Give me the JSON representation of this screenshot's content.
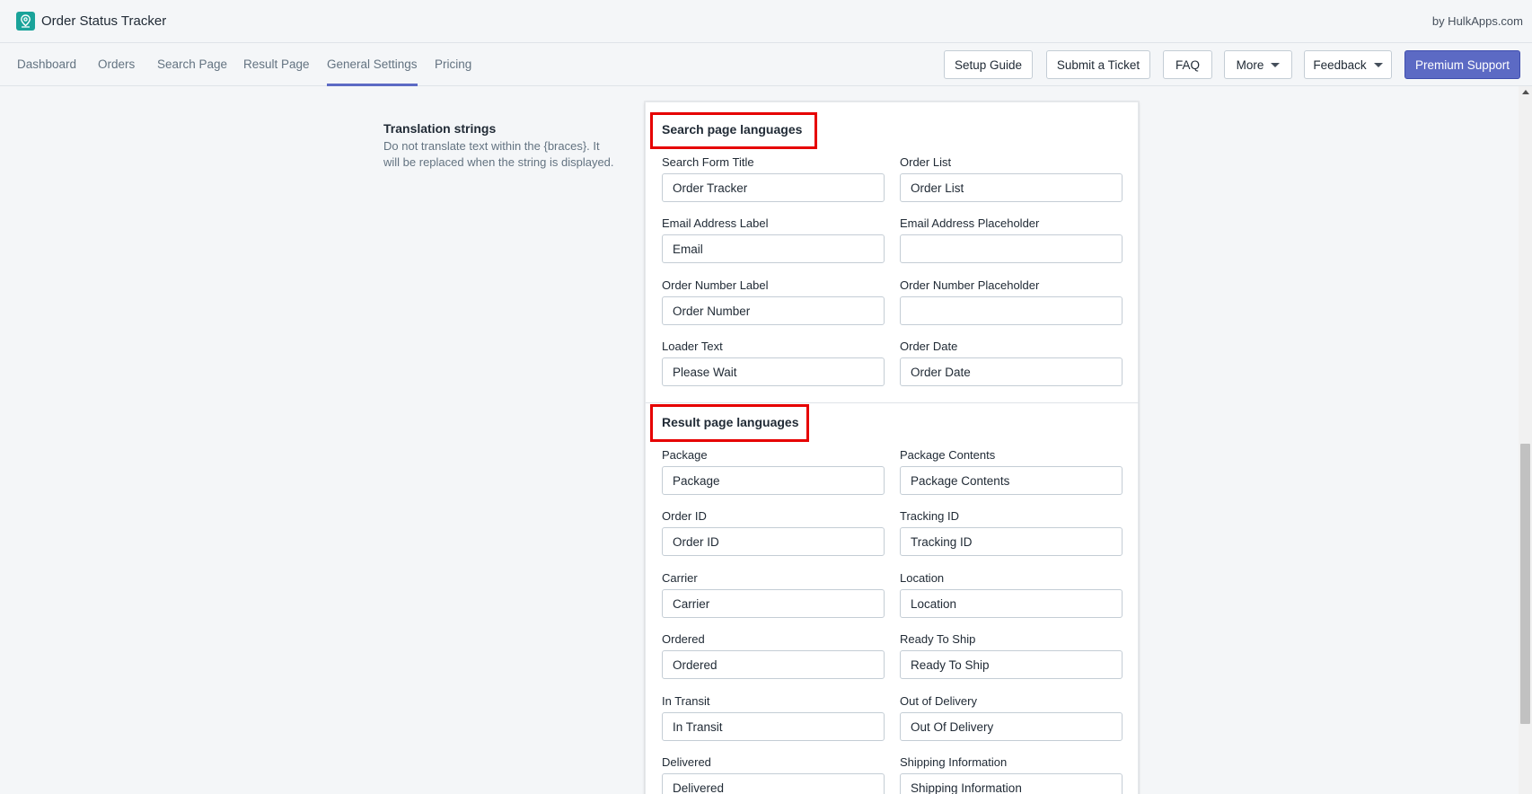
{
  "app": {
    "title": "Order Status Tracker",
    "by_line": "by HulkApps.com",
    "logo_icon": "map-pin-icon"
  },
  "nav": {
    "tabs": [
      {
        "label": "Dashboard"
      },
      {
        "label": "Orders"
      },
      {
        "label": "Search Page"
      },
      {
        "label": "Result Page"
      },
      {
        "label": "General Settings",
        "active": true
      },
      {
        "label": "Pricing"
      }
    ],
    "buttons": {
      "setup_guide": "Setup Guide",
      "submit_ticket": "Submit a Ticket",
      "faq": "FAQ",
      "more": "More",
      "feedback": "Feedback",
      "premium_support": "Premium Support"
    }
  },
  "section": {
    "title": "Translation strings",
    "description": "Do not translate text within the {braces}. It will be replaced when the string is displayed."
  },
  "search_page": {
    "title": "Search page languages",
    "fields": [
      {
        "label": "Search Form Title",
        "value": "Order Tracker"
      },
      {
        "label": "Order List",
        "value": "Order List"
      },
      {
        "label": "Email Address Label",
        "value": "Email"
      },
      {
        "label": "Email Address Placeholder",
        "value": ""
      },
      {
        "label": "Order Number Label",
        "value": "Order Number"
      },
      {
        "label": "Order Number Placeholder",
        "value": ""
      },
      {
        "label": "Loader Text",
        "value": "Please Wait"
      },
      {
        "label": "Order Date",
        "value": "Order Date"
      }
    ]
  },
  "result_page": {
    "title": "Result page languages",
    "fields": [
      {
        "label": "Package",
        "value": "Package"
      },
      {
        "label": "Package Contents",
        "value": "Package Contents"
      },
      {
        "label": "Order ID",
        "value": "Order ID"
      },
      {
        "label": "Tracking ID",
        "value": "Tracking ID"
      },
      {
        "label": "Carrier",
        "value": "Carrier"
      },
      {
        "label": "Location",
        "value": "Location"
      },
      {
        "label": "Ordered",
        "value": "Ordered"
      },
      {
        "label": "Ready To Ship",
        "value": "Ready To Ship"
      },
      {
        "label": "In Transit",
        "value": "In Transit"
      },
      {
        "label": "Out of Delivery",
        "value": "Out Of Delivery"
      },
      {
        "label": "Delivered",
        "value": "Delivered"
      },
      {
        "label": "Shipping Information",
        "value": "Shipping Information"
      }
    ]
  },
  "colors": {
    "accent": "#5c6ac4",
    "highlight": "#e60000",
    "logo": "#1aa39a"
  }
}
